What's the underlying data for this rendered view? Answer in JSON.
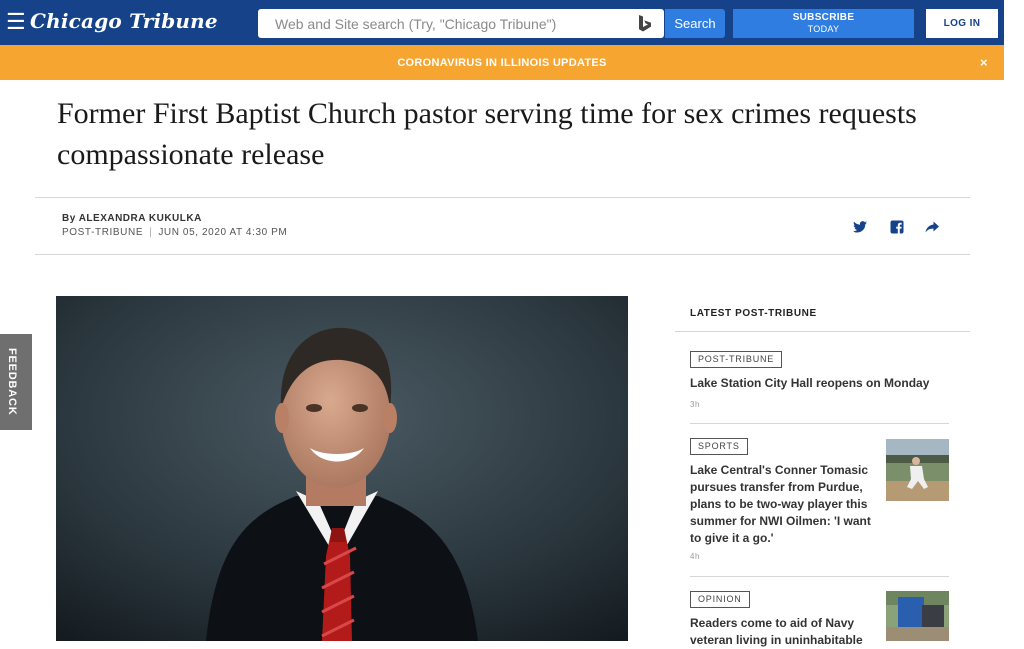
{
  "header": {
    "logo": "Chicago Tribune",
    "search_placeholder": "Web and Site search (Try, \"Chicago Tribune\")",
    "search_label": "Search",
    "subscribe_line1": "SUBSCRIBE",
    "subscribe_line2": "TODAY",
    "login_label": "LOG IN"
  },
  "alert": {
    "text": "CORONAVIRUS IN ILLINOIS UPDATES",
    "close": "×"
  },
  "article": {
    "headline": "Former First Baptist Church pastor serving time for sex crimes requests compassionate release",
    "byline": "By ALEXANDRA KUKULKA",
    "source": "POST-TRIBUNE",
    "separator": "|",
    "date": "JUN 05, 2020 AT 4:30 PM"
  },
  "feedback": {
    "label": "FEEDBACK"
  },
  "sidebar": {
    "title": "LATEST POST-TRIBUNE",
    "items": [
      {
        "tag": "POST-TRIBUNE",
        "title": "Lake Station City Hall reopens on Monday",
        "time": "3h"
      },
      {
        "tag": "SPORTS",
        "title": "Lake Central's Conner Tomasic pursues transfer from Purdue, plans to be two-way player this summer for NWI Oilmen: 'I want to give it a go.'",
        "time": "4h"
      },
      {
        "tag": "OPINION",
        "title": "Readers come to aid of Navy veteran living in uninhabitable",
        "time": ""
      }
    ]
  },
  "icons": {
    "menu": "hamburger-icon",
    "twitter": "twitter-icon",
    "facebook": "facebook-icon",
    "share": "share-arrow-icon",
    "bing": "bing-logo-icon"
  },
  "colors": {
    "header_blue": "#16428a",
    "button_blue": "#2f7de0",
    "alert_orange": "#f7a531",
    "feedback_gray": "#6f6f6f"
  }
}
